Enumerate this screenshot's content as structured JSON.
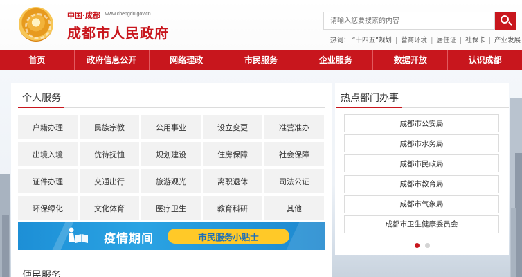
{
  "header": {
    "site_subtitle": "中国·成都",
    "site_url": "www.chengdu.gov.cn",
    "site_title": "成都市人民政府",
    "search_placeholder": "请输入您要搜索的内容",
    "hot_label": "热词：",
    "hot_words": [
      "“十四五”规划",
      "营商环境",
      "居住证",
      "社保卡",
      "产业发展"
    ]
  },
  "nav": {
    "items": [
      "首页",
      "政府信息公开",
      "网络理政",
      "市民服务",
      "企业服务",
      "数据开放",
      "认识成都"
    ]
  },
  "personal_services": {
    "title": "个人服务",
    "items": [
      "户籍办理",
      "民族宗教",
      "公用事业",
      "设立变更",
      "准营准办",
      "出境入境",
      "优待抚恤",
      "规划建设",
      "住房保障",
      "社会保障",
      "证件办理",
      "交通出行",
      "旅游观光",
      "离职退休",
      "司法公证",
      "环保绿化",
      "文化体育",
      "医疗卫生",
      "教育科研",
      "其他"
    ]
  },
  "banner": {
    "title": "疫情期间",
    "pill": "市民服务小贴士"
  },
  "hot_departments": {
    "title": "热点部门办事",
    "items": [
      "成都市公安局",
      "成都市水务局",
      "成都市民政局",
      "成都市教育局",
      "成都市气象局",
      "成都市卫生健康委员会"
    ]
  },
  "convenience": {
    "title": "便民服务"
  },
  "colors": {
    "brand_red": "#c8161d",
    "banner_blue": "#1d8fd6",
    "pill_yellow": "#ffc928"
  }
}
